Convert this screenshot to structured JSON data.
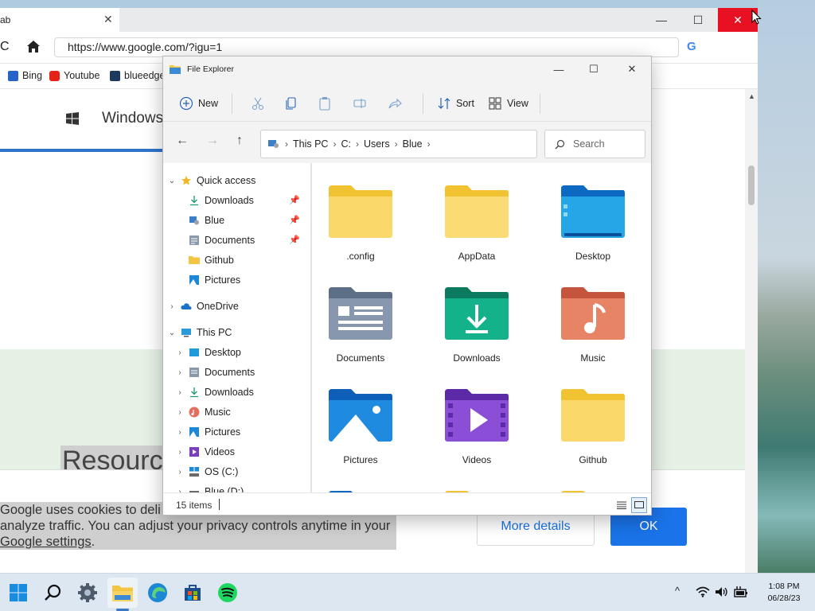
{
  "browser": {
    "tab_label": "ab",
    "tab_close": "✕",
    "window_controls": {
      "minimize": "—",
      "maximize": "☐",
      "close": "✕"
    },
    "reload_glyph": "C",
    "address": "https://www.google.com/?igu=1",
    "profile_glyph": "G",
    "bookmarks": [
      {
        "label": "Bing",
        "icon": "bing-icon",
        "color": "#2563c9"
      },
      {
        "label": "Youtube",
        "icon": "youtube-icon",
        "color": "#e62117"
      },
      {
        "label": "blueedge",
        "icon": "react-icon",
        "color": "#1e3a5f"
      }
    ],
    "page": {
      "nav_title": "Windows",
      "resource_heading": "Resourc"
    },
    "cookie": {
      "line1": "Google uses cookies to deli",
      "line2": "analyze traffic. You can adjust your privacy controls anytime in your",
      "link": "Google settings",
      "period": ".",
      "more_details": "More details",
      "ok": "OK"
    }
  },
  "explorer": {
    "title": "File Explorer",
    "window_controls": {
      "minimize": "—",
      "maximize": "☐",
      "close": "✕"
    },
    "commands": {
      "new": "New",
      "sort": "Sort",
      "view": "View"
    },
    "breadcrumb": [
      "This PC",
      "C:",
      "Users",
      "Blue"
    ],
    "search_placeholder": "Search",
    "sidebar": {
      "quick_access": "Quick access",
      "quick_items": [
        "Downloads",
        "Blue",
        "Documents",
        "Github",
        "Pictures"
      ],
      "onedrive": "OneDrive",
      "this_pc": "This PC",
      "pc_items": [
        "Desktop",
        "Documents",
        "Downloads",
        "Music",
        "Pictures",
        "Videos",
        "OS (C:)",
        "Blue (D:)"
      ]
    },
    "folders": [
      ".config",
      "AppData",
      "Desktop",
      "Documents",
      "Downloads",
      "Music",
      "Pictures",
      "Videos",
      "Github"
    ],
    "status": "15 items"
  },
  "taskbar": {
    "time": "1:08 PM",
    "date": "06/28/23",
    "tray_chevron": "^"
  },
  "colors": {
    "accent": "#1a73e8",
    "close_red": "#e81123",
    "folder_yellow": "#f7d366",
    "folder_blue": "#1e88d8"
  }
}
